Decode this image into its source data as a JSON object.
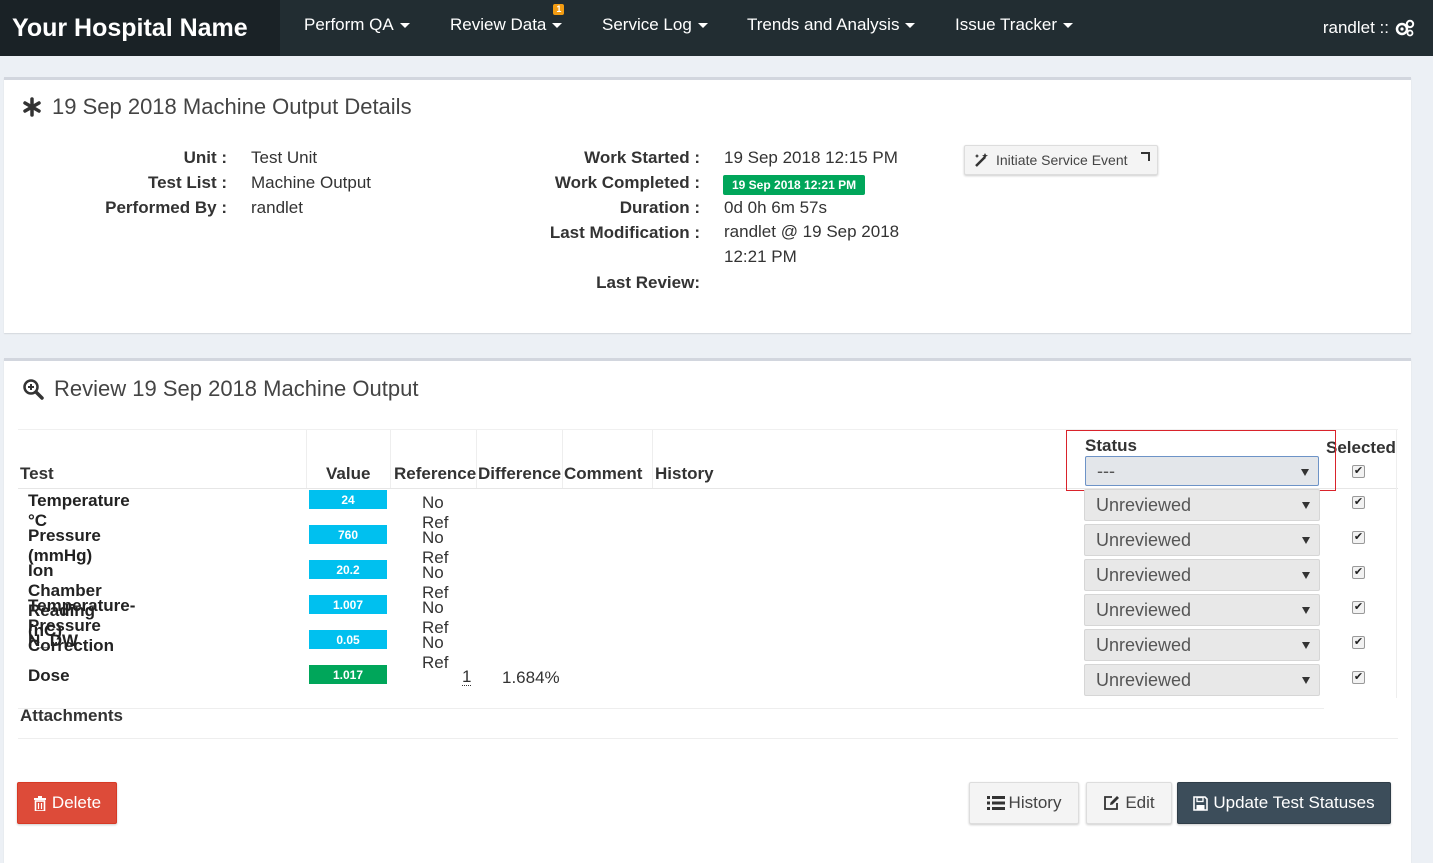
{
  "nav": {
    "brand": "Your Hospital Name",
    "items": [
      {
        "label": "Perform QA"
      },
      {
        "label": "Review Data",
        "badge": "1"
      },
      {
        "label": "Service Log"
      },
      {
        "label": "Trends and Analysis"
      },
      {
        "label": "Issue Tracker"
      }
    ],
    "user": "randlet ::"
  },
  "details": {
    "title": "19 Sep 2018 Machine Output Details",
    "unit_label": "Unit :",
    "unit": "Test Unit",
    "testlist_label": "Test List :",
    "testlist": "Machine Output",
    "performed_label": "Performed By :",
    "performed": "randlet",
    "started_label": "Work Started :",
    "started": "19 Sep 2018 12:15 PM",
    "completed_label": "Work Completed :",
    "completed": "19 Sep 2018 12:21 PM",
    "duration_label": "Duration :",
    "duration": "0d 0h 6m 57s",
    "lastmod_label": "Last Modification :",
    "lastmod_line1": "randlet @ 19 Sep 2018",
    "lastmod_line2": "12:21 PM",
    "lastreview_label": "Last Review:",
    "service_button": "Initiate Service Event"
  },
  "review": {
    "title": "Review 19 Sep 2018 Machine Output",
    "headers": {
      "test": "Test",
      "value": "Value",
      "reference": "Reference",
      "difference": "Difference",
      "comment": "Comment",
      "history": "History",
      "status": "Status",
      "selected": "Selected"
    },
    "bulk_status": "---",
    "rows": [
      {
        "name": "Temperature °C",
        "value": "24",
        "color": "#00c0ef",
        "ref": "No Ref",
        "diff": "",
        "status": "Unreviewed"
      },
      {
        "name": "Pressure (mmHg)",
        "value": "760",
        "color": "#00c0ef",
        "ref": "No Ref",
        "diff": "",
        "status": "Unreviewed"
      },
      {
        "name": "Ion Chamber Reading (nC)",
        "value": "20.2",
        "color": "#00c0ef",
        "ref": "No Ref",
        "diff": "",
        "status": "Unreviewed"
      },
      {
        "name": "Temperature-Pressure Correction",
        "value": "1.007",
        "color": "#00c0ef",
        "ref": "No Ref",
        "diff": "",
        "status": "Unreviewed"
      },
      {
        "name": "N_DW",
        "value": "0.05",
        "color": "#00c0ef",
        "ref": "No Ref",
        "diff": "",
        "status": "Unreviewed"
      },
      {
        "name": "Dose",
        "value": "1.017",
        "color": "#00a65a",
        "ref": "1",
        "diff": "1.684%",
        "status": "Unreviewed"
      }
    ],
    "attachments": "Attachments"
  },
  "actions": {
    "delete": "Delete",
    "history": "History",
    "edit": "Edit",
    "update": "Update Test Statuses"
  }
}
